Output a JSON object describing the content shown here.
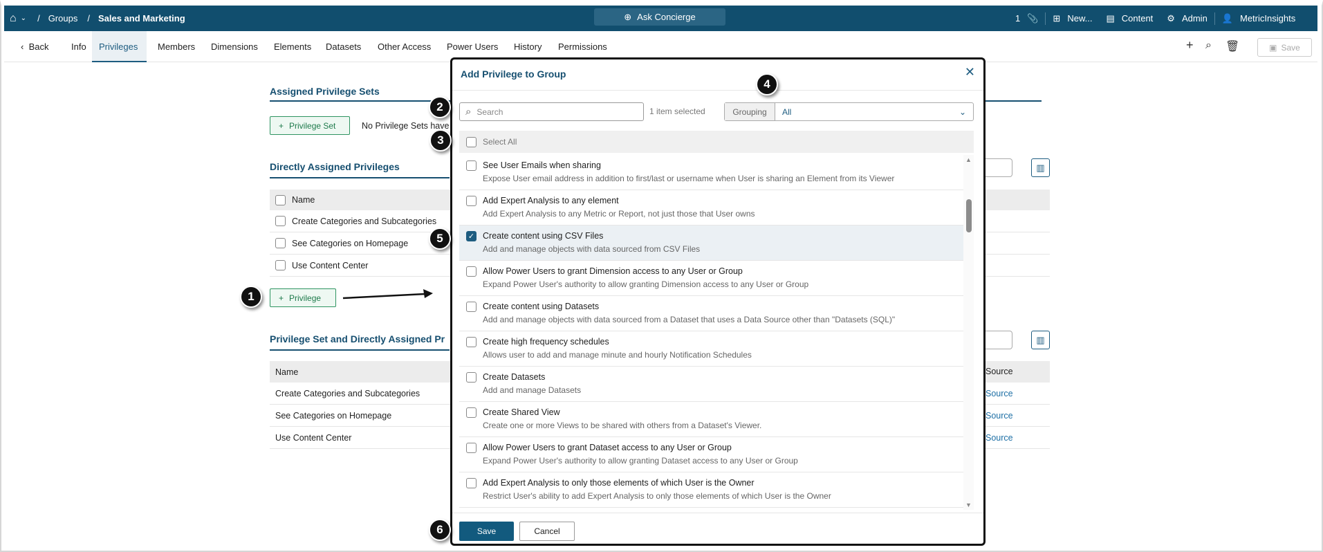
{
  "topbar": {
    "groups": "Groups",
    "current": "Sales and Marketing",
    "concierge": "Ask Concierge",
    "attachments_count": "1",
    "new": "New...",
    "content": "Content",
    "admin": "Admin",
    "user": "MetricInsights"
  },
  "tabs": {
    "back": "Back",
    "items": [
      "Info",
      "Privileges",
      "Members",
      "Dimensions",
      "Elements",
      "Datasets",
      "Other Access",
      "Power Users",
      "History",
      "Permissions"
    ],
    "active": "Privileges",
    "save": "Save"
  },
  "sets": {
    "title": "Assigned Privilege Sets",
    "button": "Privilege Set",
    "empty": "No Privilege Sets have"
  },
  "direct": {
    "title": "Directly Assigned Privileges",
    "header": "Name",
    "rows": [
      "Create Categories and Subcategories",
      "See Categories on Homepage",
      "Use Content Center"
    ],
    "button": "Privilege"
  },
  "combined": {
    "title": "Privilege Set and Directly Assigned Pr",
    "header": "Name",
    "source_header": "Source",
    "rows": [
      "Create Categories and Subcategories",
      "See Categories on Homepage",
      "Use Content Center"
    ],
    "source": "Source"
  },
  "modal": {
    "title": "Add Privilege to Group",
    "search_placeholder": "Search",
    "selected": "1 item selected",
    "grouping_label": "Grouping",
    "grouping_value": "All",
    "select_all": "Select All",
    "items": [
      {
        "title": "See User Emails when sharing",
        "desc": "Expose User email address in addition to first/last or username when User is sharing an Element from its Viewer",
        "checked": false
      },
      {
        "title": "Add Expert Analysis to any element",
        "desc": "Add Expert Analysis to any Metric or Report, not just those that User owns",
        "checked": false
      },
      {
        "title": "Create content using CSV Files",
        "desc": "Add and manage objects with data sourced from CSV Files",
        "checked": true
      },
      {
        "title": "Allow Power Users to grant Dimension access to any User or Group",
        "desc": "Expand Power User's authority to allow granting Dimension access to any User or Group",
        "checked": false
      },
      {
        "title": "Create content using Datasets",
        "desc": "Add and manage objects with data sourced from a Dataset that uses a Data Source other than \"Datasets (SQL)\"",
        "checked": false
      },
      {
        "title": "Create high frequency schedules",
        "desc": "Allows user to add and manage minute and hourly Notification Schedules",
        "checked": false
      },
      {
        "title": "Create Datasets",
        "desc": "Add and manage Datasets",
        "checked": false
      },
      {
        "title": "Create Shared View",
        "desc": "Create one or more Views to be shared with others from a Dataset's Viewer.",
        "checked": false
      },
      {
        "title": "Allow Power Users to grant Dataset access to any User or Group",
        "desc": "Expand Power User's authority to allow granting Dataset access to any User or Group",
        "checked": false
      },
      {
        "title": "Add Expert Analysis to only those elements of which User is the Owner",
        "desc": "Restrict User's ability to add Expert Analysis to only those elements of which User is the Owner",
        "checked": false
      }
    ],
    "save": "Save",
    "cancel": "Cancel"
  },
  "callouts": [
    "1",
    "2",
    "3",
    "4",
    "5",
    "6"
  ]
}
